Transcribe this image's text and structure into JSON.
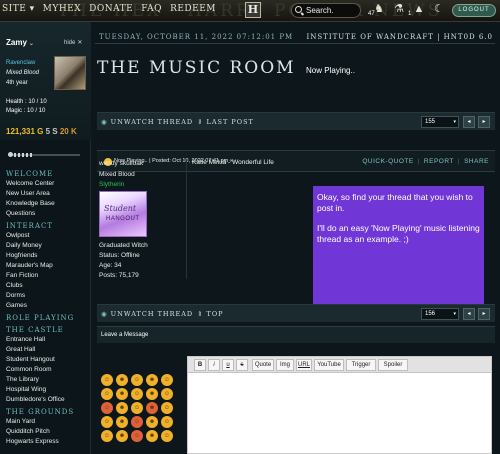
{
  "topbar": {
    "nav": [
      "SITE ▾",
      "MYHEX",
      "DONATE",
      "FAQ",
      "REDEEM"
    ],
    "banner": "THE HEX · HARRY POTTER NEWS",
    "logo_letter": "H",
    "search_label": "Search.",
    "icons": [
      {
        "name": "owl-icon",
        "glyph": "♞",
        "count": "47"
      },
      {
        "name": "flask-icon",
        "glyph": "⚗",
        "count": ""
      },
      {
        "name": "witch-hat-icon",
        "glyph": "▲",
        "count": "1"
      },
      {
        "name": "moon-icon",
        "glyph": "☾",
        "count": ""
      }
    ],
    "logout_label": "LOGOUT"
  },
  "sidebar": {
    "username": "Zamy",
    "hide_label": "hide",
    "house": "Ravenclaw",
    "blood": "Mixed Blood",
    "year": "4th year",
    "health": "Health : 10 / 10",
    "magic": "Magic : 10 / 10",
    "money": {
      "galleons": "121,331 G",
      "sickles": "5 S",
      "knuts": "20 K"
    },
    "sections": [
      {
        "title": "WELCOME",
        "items": [
          "Welcome Center",
          "New User Area",
          "Knowledge Base",
          "Questions"
        ]
      },
      {
        "title": "INTERACT",
        "items": [
          "Owlpost",
          "Daily Money",
          "Hogfriends",
          "Marauder's Map",
          "Fan Fiction",
          "Clubs",
          "Dorms",
          "Games"
        ]
      },
      {
        "title": "ROLE PLAYING",
        "items": []
      },
      {
        "title": "THE CASTLE",
        "items": [
          "Entrance Hall",
          "Great Hall",
          "Student Hangout",
          "Common Room",
          "The Library",
          "Hospital Wing",
          "Dumbledore's Office"
        ]
      },
      {
        "title": "THE GROUNDS",
        "items": [
          "Main Yard",
          "Quidditch Pitch",
          "Hogwarts Express"
        ]
      }
    ]
  },
  "main": {
    "date": "TUESDAY, OCTOBER 11, 2022 07:12:01 PM",
    "institute": "INSTITUTE OF WANDCRAFT | HNT0D 6.0",
    "title": "THE MUSIC ROOM",
    "subtitle": "Now Playing..",
    "bar_top": {
      "unwatch": "UNWATCH THREAD",
      "second": "LAST POST",
      "page": "155"
    },
    "bar_bottom": {
      "unwatch": "UNWATCH THREAD",
      "second": "TOP",
      "page": "156"
    },
    "post": {
      "info": "Now Playing.. | Posted: Oct 10, 2022 07:41 pm ∞",
      "actions": [
        "QUICK-QUOTE",
        "REPORT",
        "SHARE"
      ],
      "author": {
        "name": "wendy skulloak",
        "blood": "Mixed Blood",
        "house": "Slytherin",
        "avatar_line1": "Student",
        "avatar_line2": "HANGOUT",
        "grad": "Graduated Witch",
        "status": "Status: Offline",
        "age": "Age: 34",
        "posts": "Posts: 75,179"
      },
      "text": "Katie Melua - Wonderful Life"
    },
    "overlay": {
      "p1": "Okay, so find your thread that you wish to post in.",
      "p2": "I'll do an easy 'Now Playing' music listening thread as an example. ;)"
    },
    "leave_message": "Leave a Message",
    "emojis": [
      "☺",
      "☻",
      "☺",
      "☻",
      "☺",
      "☺",
      "☻",
      "☺",
      "☻",
      "☺",
      "☺",
      "☻",
      "☺",
      "☻",
      "☺",
      "☺",
      "☻",
      "☺",
      "☻",
      "☺",
      "☺",
      "☻",
      "☺",
      "☻",
      "☺"
    ],
    "toolbar": [
      "B",
      "i",
      "u",
      "s",
      "Quote",
      "Img",
      "URL",
      "YouTube",
      "Trigger",
      "Spoiler"
    ]
  },
  "colors": {
    "accent": "#7ec4c6",
    "overlay": "#7137d6",
    "gold": "#f0c020"
  }
}
